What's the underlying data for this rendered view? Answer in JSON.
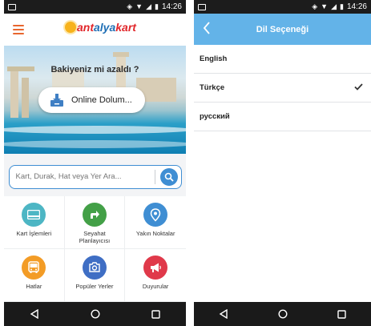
{
  "status_bar": {
    "time": "14:26"
  },
  "left_screen": {
    "logo": {
      "part1": "ant",
      "part2": "alya",
      "part3": "kart"
    },
    "hero": {
      "title": "Bakiyeniz mi azaldı ?",
      "button_label": "Online Dolum..."
    },
    "search": {
      "placeholder": "Kart, Durak, Hat veya Yer Ara..."
    },
    "tiles": [
      {
        "label": "Kart İşlemleri",
        "icon": "card-icon",
        "color": "#4db6c4"
      },
      {
        "label": "Seyahat Planlayıcısı",
        "icon": "route-arrow-icon",
        "color": "#43a047"
      },
      {
        "label": "Yakın Noktalar",
        "icon": "location-pin-icon",
        "color": "#3f8ed3"
      },
      {
        "label": "Hatlar",
        "icon": "bus-icon",
        "color": "#f39c26"
      },
      {
        "label": "Popüler Yerler",
        "icon": "camera-icon",
        "color": "#3f6ec4"
      },
      {
        "label": "Duyurular",
        "icon": "megaphone-icon",
        "color": "#e0394a"
      }
    ]
  },
  "right_screen": {
    "header": {
      "title": "Dil Seçeneği"
    },
    "languages": [
      {
        "label": "English",
        "selected": false
      },
      {
        "label": "Türkçe",
        "selected": true
      },
      {
        "label": "русский",
        "selected": false
      }
    ]
  },
  "colors": {
    "accent_orange": "#e8662e",
    "accent_blue": "#3f8ed3",
    "header_blue": "#63b3e8"
  }
}
